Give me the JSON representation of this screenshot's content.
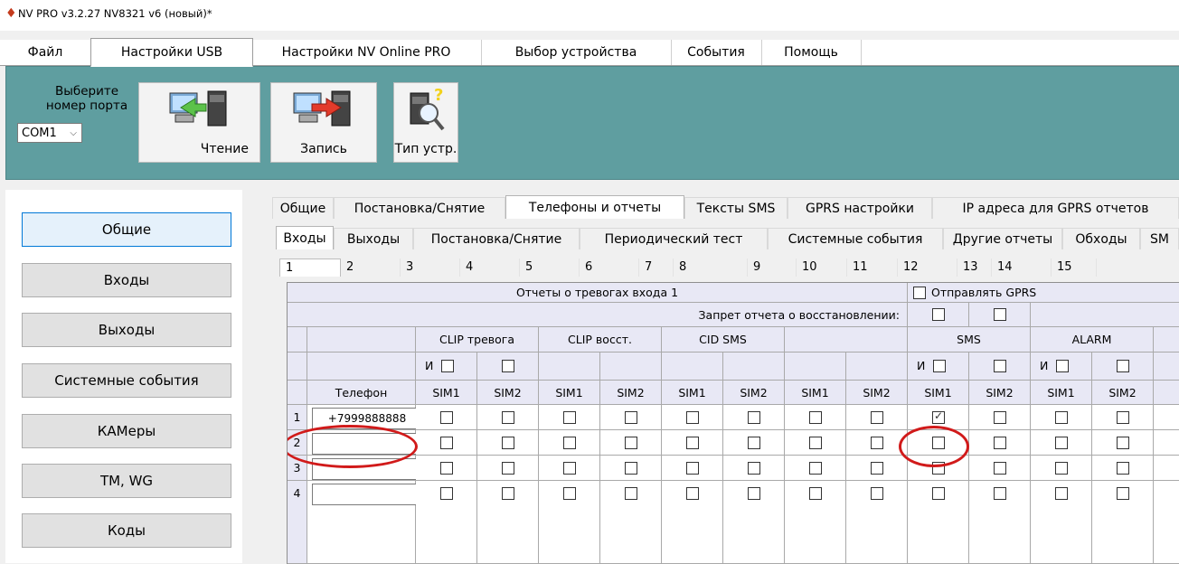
{
  "window": {
    "title": "NV PRO v3.2.27 NV8321 v6 (новый)*"
  },
  "menu": {
    "tabs": [
      "Файл",
      "Настройки USB",
      "Настройки NV Online PRO",
      "Выбор устройства",
      "События",
      "Помощь"
    ],
    "active": "Настройки USB"
  },
  "ribbon": {
    "port_label_line1": "Выберите",
    "port_label_line2": "номер порта",
    "port_value": "COM1",
    "read_label": "Чтение",
    "write_label": "Запись",
    "type_label": "Тип устр."
  },
  "nav": {
    "items": [
      "Общие",
      "Входы",
      "Выходы",
      "Системные события",
      "КАМеры",
      "TM, WG",
      "Коды"
    ],
    "active": "Общие"
  },
  "tabs_main": {
    "items": [
      "Общие",
      "Постановка/Снятие",
      "Телефоны и отчеты",
      "Тексты SMS",
      "GPRS настройки",
      "IP адреса для GPRS отчетов"
    ],
    "active": "Телефоны и отчеты"
  },
  "tabs_sub": {
    "items": [
      "Входы",
      "Выходы",
      "Постановка/Снятие",
      "Периодический тест",
      "Системные события",
      "Другие отчеты",
      "Обходы",
      "SM"
    ],
    "active": "Входы"
  },
  "input_tabs": {
    "items": [
      "1",
      "2",
      "3",
      "4",
      "5",
      "6",
      "7",
      "8",
      "9",
      "10",
      "11",
      "12",
      "13",
      "14",
      "15"
    ],
    "active": "1"
  },
  "grid": {
    "title": "Отчеты о тревогах входа 1",
    "send_gprs_label": "Отправлять GPRS",
    "restore_ban_label": "Запрет отчета о восстановлении:",
    "group_clip_alarm": "CLIP тревога",
    "group_clip_restore": "CLIP восст.",
    "group_cid_sms": "CID SMS",
    "group_sms": "SMS",
    "group_alarm": "ALARM",
    "and_label": "И",
    "phone_header": "Телефон",
    "sim1": "SIM1",
    "sim2": "SIM2",
    "rows": [
      {
        "num": "1",
        "phone": "+7999888888",
        "sms_sim1_checked": true
      },
      {
        "num": "2",
        "phone": "",
        "sms_sim1_checked": false
      },
      {
        "num": "3",
        "phone": "",
        "sms_sim1_checked": false
      },
      {
        "num": "4",
        "phone": "",
        "sms_sim1_checked": false
      }
    ]
  },
  "colors": {
    "ribbon": "#5f9ea0",
    "annotation": "#d11a1a",
    "grid_header": "#e8e8f5"
  }
}
